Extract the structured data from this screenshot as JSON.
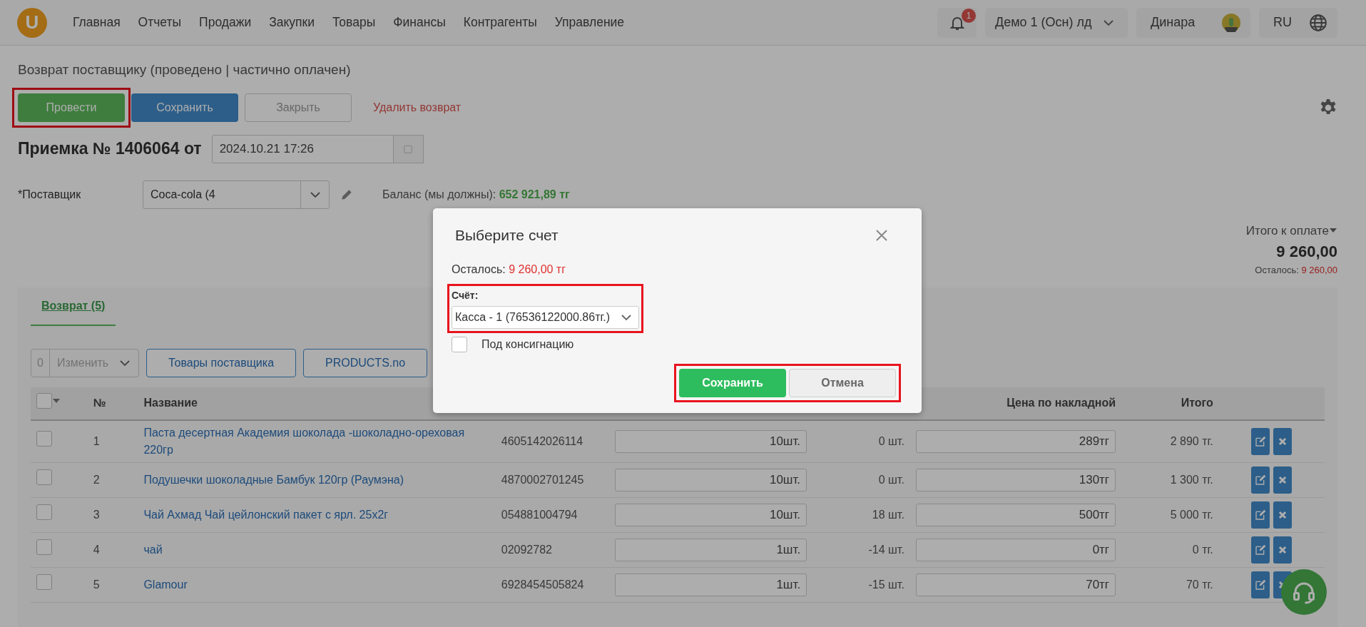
{
  "nav": {
    "logo": "U",
    "items": [
      "Главная",
      "Отчеты",
      "Продажи",
      "Закупки",
      "Товары",
      "Финансы",
      "Контрагенты",
      "Управление"
    ],
    "notifications": "1",
    "company": "Демо 1 (Осн) лд",
    "user": "Динара",
    "language": "RU"
  },
  "page": {
    "title": "Возврат поставщику (проведено | частично оплачен)",
    "actions": [
      {
        "label": "Провести",
        "kind": "success",
        "highlighted": true
      },
      {
        "label": "Сохранить",
        "kind": "primary",
        "highlighted": false
      },
      {
        "label": "Закрыть",
        "kind": "light",
        "highlighted": false
      },
      {
        "label": "Удалить возврат",
        "kind": "link",
        "highlighted": false
      }
    ],
    "receipt": {
      "heading": "Приемка № 1406064 от",
      "date": "2024.10.21 17:26"
    },
    "supplier": {
      "label": "*Поставщик",
      "value": "Coca-cola (4",
      "balance_label": "Баланс (мы должны):",
      "balance": "652 921,89 тг"
    },
    "totals": {
      "label": "Итого к оплате",
      "amount": "9 260,00",
      "remaining_label": "Осталось:",
      "remaining": "9 260,00"
    }
  },
  "tabs": [
    {
      "label": "Возврат (5)",
      "selected": true
    }
  ],
  "toolbar": {
    "count": "0",
    "bulk": "Изменить",
    "buttons": [
      "Товары поставщика",
      "PRODUCTS.no"
    ]
  },
  "table": {
    "all_checked": false,
    "header": {
      "number": "№",
      "name": "Название",
      "price": "Цена по накладной",
      "total": "Итого"
    },
    "rows": [
      {
        "checked": false,
        "number": "1",
        "name": "Паста десертная Академия шоколада -шоколадно-ореховая 220гр",
        "barcode": "4605142026114",
        "quantity": "10шт.",
        "stock": "0 шт.",
        "price": "289тг",
        "total": "2 890 тг."
      },
      {
        "checked": false,
        "number": "2",
        "name": "Подушечки шоколадные Бамбук 120гр (Раумэна)",
        "barcode": "4870002701245",
        "quantity": "10шт.",
        "stock": "0 шт.",
        "price": "130тг",
        "total": "1 300 тг."
      },
      {
        "checked": false,
        "number": "3",
        "name": "Чай Ахмад Чай цейлонский пакет с ярл. 25х2г",
        "barcode": "054881004794",
        "quantity": "10шт.",
        "stock": "18 шт.",
        "price": "500тг",
        "total": "5 000 тг."
      },
      {
        "checked": false,
        "number": "4",
        "name": "чай",
        "barcode": "02092782",
        "quantity": "1шт.",
        "stock": "-14 шт.",
        "price": "0тг",
        "total": "0 тг."
      },
      {
        "checked": false,
        "number": "5",
        "name": "Glamour",
        "barcode": "6928454505824",
        "quantity": "1шт.",
        "stock": "-15 шт.",
        "price": "70тг",
        "total": "70 тг."
      }
    ]
  },
  "modal": {
    "title": "Выберите счет",
    "remaining_label": "Осталось:",
    "remaining": "9 260,00 тг",
    "account_label": "Счёт:",
    "account": "Касса - 1 (76536122000.86тг.)",
    "account_highlighted": true,
    "consignment": {
      "label": "Под консигнацию",
      "checked": false
    },
    "buttons": [
      {
        "label": "Сохранить",
        "kind": "success"
      },
      {
        "label": "Отмена",
        "kind": "light"
      }
    ],
    "buttons_highlighted": true
  }
}
